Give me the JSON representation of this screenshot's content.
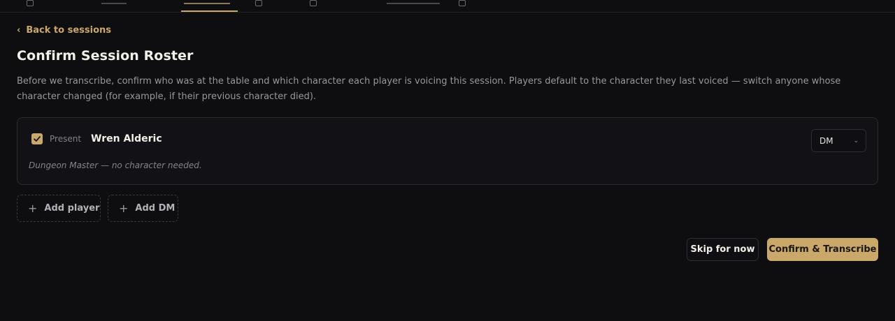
{
  "nav": {
    "tabs": [
      {
        "icon": "document-icon",
        "active": false
      },
      {
        "icon": "users-icon",
        "active": false
      },
      {
        "icon": "sessions-icon",
        "active": true
      },
      {
        "icon": "calendar-icon",
        "active": false
      },
      {
        "icon": "notes-icon",
        "active": false
      },
      {
        "icon": "chart-icon",
        "active": false
      },
      {
        "icon": "grid-icon",
        "active": false
      }
    ]
  },
  "back_link": "Back to sessions",
  "page_title": "Confirm Session Roster",
  "intro": "Before we transcribe, confirm who was at the table and which character each player is voicing this session. Players default to the character they last voiced — switch anyone whose character changed (for example, if their previous character died).",
  "roster": {
    "entries": [
      {
        "present_label": "Present",
        "present_checked": true,
        "name": "Wren Alderic",
        "role": "DM",
        "note": "Dungeon Master — no character needed."
      }
    ]
  },
  "actions": {
    "add_player": "Add player",
    "add_dm": "Add DM",
    "skip": "Skip for now",
    "confirm": "Confirm & Transcribe"
  },
  "colors": {
    "accent": "#c9a86a",
    "background": "#0e0d10",
    "card": "#121115"
  }
}
